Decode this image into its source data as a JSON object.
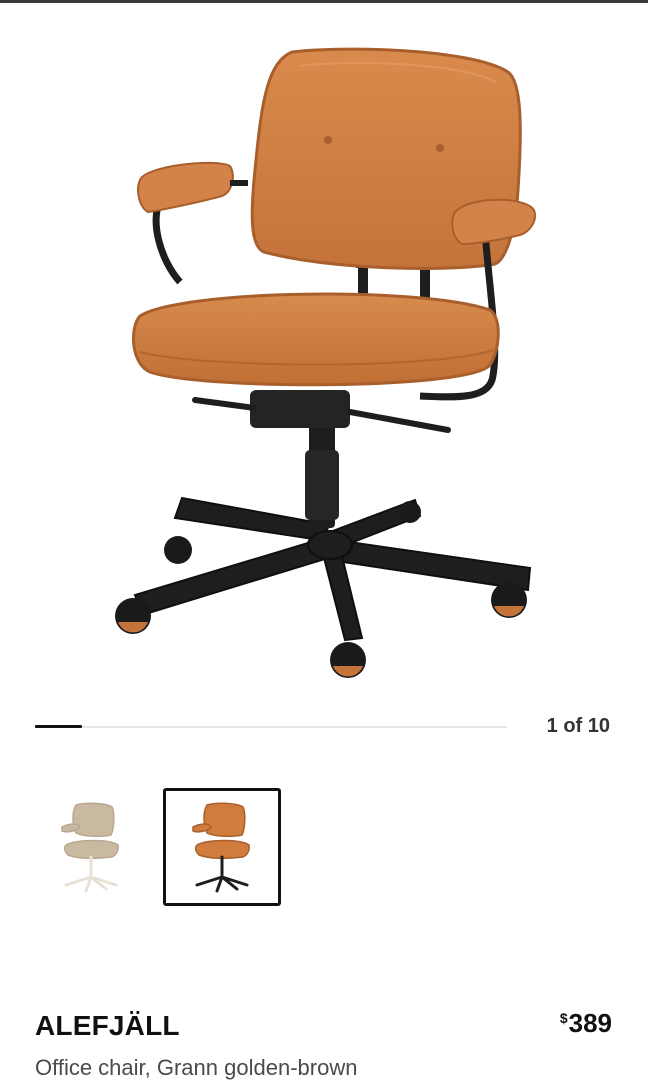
{
  "product": {
    "name": "ALEFJÄLL",
    "description": "Office chair, Grann golden-brown",
    "price_symbol": "$",
    "price_amount": "389"
  },
  "gallery": {
    "counter": "1 of 10",
    "current_index": 1,
    "total": 10,
    "progress_fraction": 0.1
  },
  "variants": [
    {
      "icon": "office-chair-beige",
      "color": "#c9b9a0",
      "selected": false
    },
    {
      "icon": "office-chair-golden-brown",
      "color": "#cf7c3d",
      "selected": true
    }
  ],
  "colors": {
    "leather": "#cf7c3d",
    "frame": "#1e1e1e",
    "beige": "#c9b9a0",
    "track": "#e6e6e6"
  }
}
